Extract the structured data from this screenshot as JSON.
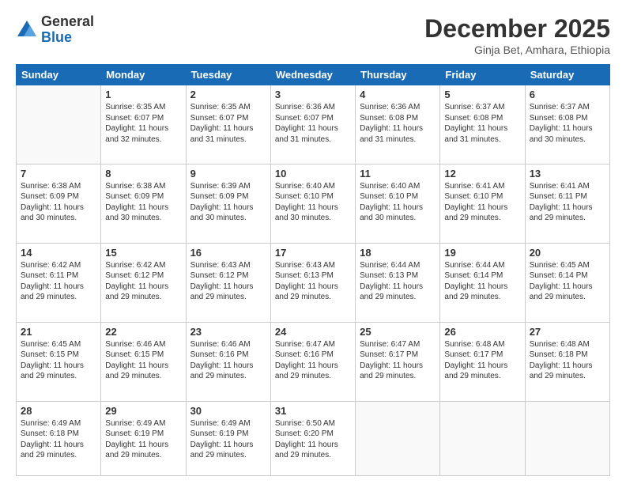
{
  "logo": {
    "general": "General",
    "blue": "Blue"
  },
  "header": {
    "month": "December 2025",
    "location": "Ginja Bet, Amhara, Ethiopia"
  },
  "weekdays": [
    "Sunday",
    "Monday",
    "Tuesday",
    "Wednesday",
    "Thursday",
    "Friday",
    "Saturday"
  ],
  "weeks": [
    [
      {
        "day": "",
        "sunrise": "",
        "sunset": "",
        "daylight": "",
        "empty": true
      },
      {
        "day": "1",
        "sunrise": "Sunrise: 6:35 AM",
        "sunset": "Sunset: 6:07 PM",
        "daylight": "Daylight: 11 hours and 32 minutes."
      },
      {
        "day": "2",
        "sunrise": "Sunrise: 6:35 AM",
        "sunset": "Sunset: 6:07 PM",
        "daylight": "Daylight: 11 hours and 31 minutes."
      },
      {
        "day": "3",
        "sunrise": "Sunrise: 6:36 AM",
        "sunset": "Sunset: 6:07 PM",
        "daylight": "Daylight: 11 hours and 31 minutes."
      },
      {
        "day": "4",
        "sunrise": "Sunrise: 6:36 AM",
        "sunset": "Sunset: 6:08 PM",
        "daylight": "Daylight: 11 hours and 31 minutes."
      },
      {
        "day": "5",
        "sunrise": "Sunrise: 6:37 AM",
        "sunset": "Sunset: 6:08 PM",
        "daylight": "Daylight: 11 hours and 31 minutes."
      },
      {
        "day": "6",
        "sunrise": "Sunrise: 6:37 AM",
        "sunset": "Sunset: 6:08 PM",
        "daylight": "Daylight: 11 hours and 30 minutes."
      }
    ],
    [
      {
        "day": "7",
        "sunrise": "Sunrise: 6:38 AM",
        "sunset": "Sunset: 6:09 PM",
        "daylight": "Daylight: 11 hours and 30 minutes."
      },
      {
        "day": "8",
        "sunrise": "Sunrise: 6:38 AM",
        "sunset": "Sunset: 6:09 PM",
        "daylight": "Daylight: 11 hours and 30 minutes."
      },
      {
        "day": "9",
        "sunrise": "Sunrise: 6:39 AM",
        "sunset": "Sunset: 6:09 PM",
        "daylight": "Daylight: 11 hours and 30 minutes."
      },
      {
        "day": "10",
        "sunrise": "Sunrise: 6:40 AM",
        "sunset": "Sunset: 6:10 PM",
        "daylight": "Daylight: 11 hours and 30 minutes."
      },
      {
        "day": "11",
        "sunrise": "Sunrise: 6:40 AM",
        "sunset": "Sunset: 6:10 PM",
        "daylight": "Daylight: 11 hours and 30 minutes."
      },
      {
        "day": "12",
        "sunrise": "Sunrise: 6:41 AM",
        "sunset": "Sunset: 6:10 PM",
        "daylight": "Daylight: 11 hours and 29 minutes."
      },
      {
        "day": "13",
        "sunrise": "Sunrise: 6:41 AM",
        "sunset": "Sunset: 6:11 PM",
        "daylight": "Daylight: 11 hours and 29 minutes."
      }
    ],
    [
      {
        "day": "14",
        "sunrise": "Sunrise: 6:42 AM",
        "sunset": "Sunset: 6:11 PM",
        "daylight": "Daylight: 11 hours and 29 minutes."
      },
      {
        "day": "15",
        "sunrise": "Sunrise: 6:42 AM",
        "sunset": "Sunset: 6:12 PM",
        "daylight": "Daylight: 11 hours and 29 minutes."
      },
      {
        "day": "16",
        "sunrise": "Sunrise: 6:43 AM",
        "sunset": "Sunset: 6:12 PM",
        "daylight": "Daylight: 11 hours and 29 minutes."
      },
      {
        "day": "17",
        "sunrise": "Sunrise: 6:43 AM",
        "sunset": "Sunset: 6:13 PM",
        "daylight": "Daylight: 11 hours and 29 minutes."
      },
      {
        "day": "18",
        "sunrise": "Sunrise: 6:44 AM",
        "sunset": "Sunset: 6:13 PM",
        "daylight": "Daylight: 11 hours and 29 minutes."
      },
      {
        "day": "19",
        "sunrise": "Sunrise: 6:44 AM",
        "sunset": "Sunset: 6:14 PM",
        "daylight": "Daylight: 11 hours and 29 minutes."
      },
      {
        "day": "20",
        "sunrise": "Sunrise: 6:45 AM",
        "sunset": "Sunset: 6:14 PM",
        "daylight": "Daylight: 11 hours and 29 minutes."
      }
    ],
    [
      {
        "day": "21",
        "sunrise": "Sunrise: 6:45 AM",
        "sunset": "Sunset: 6:15 PM",
        "daylight": "Daylight: 11 hours and 29 minutes."
      },
      {
        "day": "22",
        "sunrise": "Sunrise: 6:46 AM",
        "sunset": "Sunset: 6:15 PM",
        "daylight": "Daylight: 11 hours and 29 minutes."
      },
      {
        "day": "23",
        "sunrise": "Sunrise: 6:46 AM",
        "sunset": "Sunset: 6:16 PM",
        "daylight": "Daylight: 11 hours and 29 minutes."
      },
      {
        "day": "24",
        "sunrise": "Sunrise: 6:47 AM",
        "sunset": "Sunset: 6:16 PM",
        "daylight": "Daylight: 11 hours and 29 minutes."
      },
      {
        "day": "25",
        "sunrise": "Sunrise: 6:47 AM",
        "sunset": "Sunset: 6:17 PM",
        "daylight": "Daylight: 11 hours and 29 minutes."
      },
      {
        "day": "26",
        "sunrise": "Sunrise: 6:48 AM",
        "sunset": "Sunset: 6:17 PM",
        "daylight": "Daylight: 11 hours and 29 minutes."
      },
      {
        "day": "27",
        "sunrise": "Sunrise: 6:48 AM",
        "sunset": "Sunset: 6:18 PM",
        "daylight": "Daylight: 11 hours and 29 minutes."
      }
    ],
    [
      {
        "day": "28",
        "sunrise": "Sunrise: 6:49 AM",
        "sunset": "Sunset: 6:18 PM",
        "daylight": "Daylight: 11 hours and 29 minutes."
      },
      {
        "day": "29",
        "sunrise": "Sunrise: 6:49 AM",
        "sunset": "Sunset: 6:19 PM",
        "daylight": "Daylight: 11 hours and 29 minutes."
      },
      {
        "day": "30",
        "sunrise": "Sunrise: 6:49 AM",
        "sunset": "Sunset: 6:19 PM",
        "daylight": "Daylight: 11 hours and 29 minutes."
      },
      {
        "day": "31",
        "sunrise": "Sunrise: 6:50 AM",
        "sunset": "Sunset: 6:20 PM",
        "daylight": "Daylight: 11 hours and 29 minutes."
      },
      {
        "day": "",
        "sunrise": "",
        "sunset": "",
        "daylight": "",
        "empty": true
      },
      {
        "day": "",
        "sunrise": "",
        "sunset": "",
        "daylight": "",
        "empty": true
      },
      {
        "day": "",
        "sunrise": "",
        "sunset": "",
        "daylight": "",
        "empty": true
      }
    ]
  ]
}
